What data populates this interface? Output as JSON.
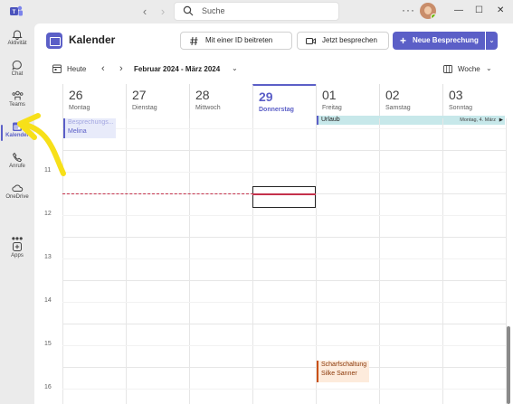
{
  "search": {
    "placeholder": "Suche"
  },
  "rail": {
    "items": [
      {
        "label": "Aktivität",
        "icon": "bell-icon"
      },
      {
        "label": "Chat",
        "icon": "chat-icon"
      },
      {
        "label": "Teams",
        "icon": "teams-icon"
      },
      {
        "label": "Kalender",
        "icon": "calendar-icon",
        "active": true
      },
      {
        "label": "Anrufe",
        "icon": "phone-icon"
      },
      {
        "label": "OneDrive",
        "icon": "cloud-icon"
      },
      {
        "label": "Apps",
        "icon": "apps-icon"
      }
    ],
    "more": "•••"
  },
  "header": {
    "title": "Kalender",
    "join_label": "Mit einer ID beitreten",
    "meet_label": "Jetzt besprechen",
    "new_label": "Neue Besprechung"
  },
  "nav": {
    "today_label": "Heute",
    "range_label": "Februar 2024 - März 2024",
    "view_label": "Woche"
  },
  "days": [
    {
      "num": "26",
      "name": "Montag"
    },
    {
      "num": "27",
      "name": "Dienstag"
    },
    {
      "num": "28",
      "name": "Mittwoch"
    },
    {
      "num": "29",
      "name": "Donnerstag",
      "today": true
    },
    {
      "num": "01",
      "name": "Freitag"
    },
    {
      "num": "02",
      "name": "Samstag"
    },
    {
      "num": "03",
      "name": "Sonntag"
    }
  ],
  "allday_event": {
    "title": "Urlaub",
    "until": "Montag, 4. März"
  },
  "hours": [
    "11",
    "12",
    "13",
    "14",
    "15",
    "16"
  ],
  "events": {
    "melina": {
      "title": "Besprechungs...",
      "person": "Melina"
    },
    "scharf": {
      "title": "Scharfschaltung",
      "person": "Silke Sanner"
    }
  },
  "colors": {
    "accent": "#5b5fc7",
    "now": "#c4314b",
    "allday": "#c7e8ea",
    "annotation": "#f7e019"
  }
}
